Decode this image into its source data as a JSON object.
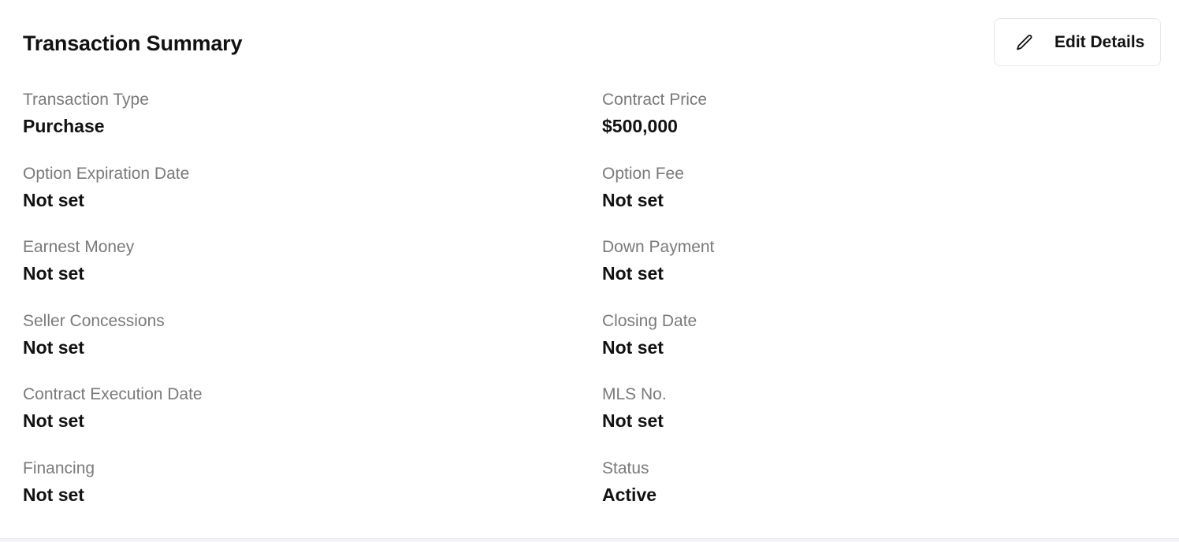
{
  "header": {
    "title": "Transaction Summary",
    "edit_button_label": "Edit Details",
    "edit_icon": "pencil-icon"
  },
  "fields": [
    {
      "label": "Transaction Type",
      "value": "Purchase"
    },
    {
      "label": "Contract Price",
      "value": "$500,000"
    },
    {
      "label": "Option Expiration Date",
      "value": "Not set"
    },
    {
      "label": "Option Fee",
      "value": "Not set"
    },
    {
      "label": "Earnest Money",
      "value": "Not set"
    },
    {
      "label": "Down Payment",
      "value": "Not set"
    },
    {
      "label": "Seller Concessions",
      "value": "Not set"
    },
    {
      "label": "Closing Date",
      "value": "Not set"
    },
    {
      "label": "Contract Execution Date",
      "value": "Not set"
    },
    {
      "label": "MLS No.",
      "value": "Not set"
    },
    {
      "label": "Financing",
      "value": "Not set"
    },
    {
      "label": "Status",
      "value": "Active"
    }
  ],
  "colors": {
    "text_primary": "#111111",
    "text_label": "#7a7a7a",
    "border": "#e5e7eb",
    "background": "#ffffff"
  }
}
